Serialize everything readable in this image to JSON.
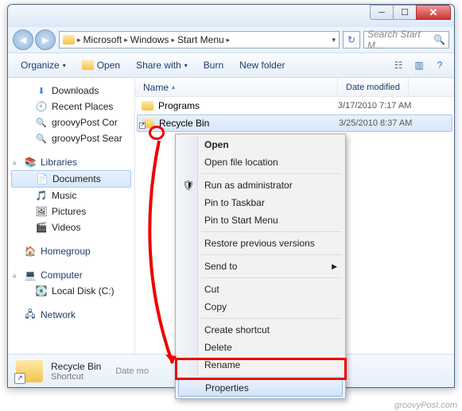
{
  "titlebar": {
    "min": "─",
    "max": "☐",
    "close": "✕"
  },
  "nav_buttons": {
    "back": "◄",
    "fwd": "►"
  },
  "address": {
    "icon": "folder",
    "crumbs": [
      "Microsoft",
      "Windows",
      "Start Menu"
    ],
    "sep": "▸",
    "dropdown": "▾",
    "refresh": "↻"
  },
  "search": {
    "placeholder": "Search Start M...",
    "icon": "🔍"
  },
  "toolbar": {
    "organize": "Organize",
    "open": "Open",
    "share": "Share with",
    "burn": "Burn",
    "newfolder": "New folder",
    "dd": "▾"
  },
  "sidebar": {
    "favorites": {
      "items": [
        {
          "label": "Downloads",
          "icon": "dl"
        },
        {
          "label": "Recent Places",
          "icon": "recent"
        },
        {
          "label": "groovyPost Cor",
          "icon": "search"
        },
        {
          "label": "groovyPost Sear",
          "icon": "search"
        }
      ]
    },
    "libraries": {
      "label": "Libraries",
      "items": [
        {
          "label": "Documents",
          "icon": "doc",
          "selected": true
        },
        {
          "label": "Music",
          "icon": "music"
        },
        {
          "label": "Pictures",
          "icon": "pic"
        },
        {
          "label": "Videos",
          "icon": "vid"
        }
      ]
    },
    "homegroup": {
      "label": "Homegroup"
    },
    "computer": {
      "label": "Computer",
      "items": [
        {
          "label": "Local Disk (C:)",
          "icon": "disk"
        }
      ]
    },
    "network": {
      "label": "Network"
    }
  },
  "columns": {
    "name": "Name",
    "date": "Date modified",
    "sort": "▴"
  },
  "rows": [
    {
      "name": "Programs",
      "date": "3/17/2010 7:17 AM",
      "icon": "folder",
      "selected": false,
      "shortcut": false
    },
    {
      "name": "Recycle Bin",
      "date": "3/25/2010 8:37 AM",
      "icon": "folder",
      "selected": true,
      "shortcut": true
    }
  ],
  "details": {
    "name": "Recycle Bin",
    "type": "Shortcut",
    "date_label": "Date mo"
  },
  "context_menu": {
    "items": [
      {
        "label": "Open",
        "bold": true
      },
      {
        "label": "Open file location"
      },
      {
        "sep": true
      },
      {
        "label": "Run as administrator",
        "icon": "🛡"
      },
      {
        "label": "Pin to Taskbar"
      },
      {
        "label": "Pin to Start Menu"
      },
      {
        "sep": true
      },
      {
        "label": "Restore previous versions"
      },
      {
        "sep": true
      },
      {
        "label": "Send to",
        "submenu": true
      },
      {
        "sep": true
      },
      {
        "label": "Cut"
      },
      {
        "label": "Copy"
      },
      {
        "sep": true
      },
      {
        "label": "Create shortcut"
      },
      {
        "label": "Delete"
      },
      {
        "label": "Rename"
      },
      {
        "sep": true
      },
      {
        "label": "Properties",
        "highlight": true
      }
    ]
  },
  "watermark": "groovyPost.com"
}
